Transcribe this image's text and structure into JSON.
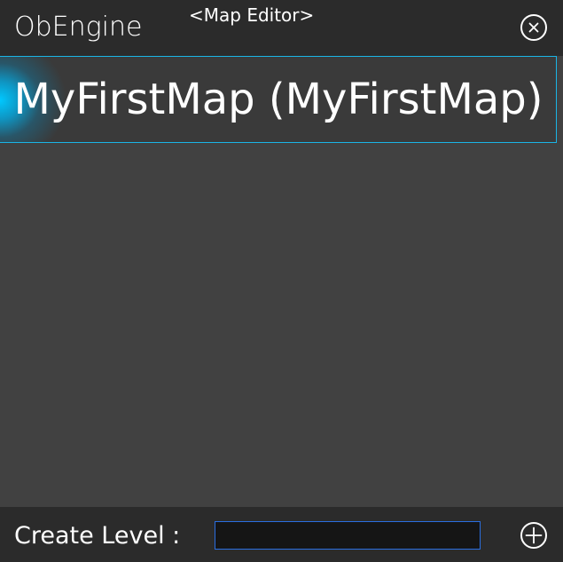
{
  "window": {
    "app_title": "ObEngine",
    "subtitle": "<Map Editor>",
    "close_icon": "close-icon"
  },
  "maps": [
    {
      "label": "MyFirstMap (MyFirstMap)",
      "selected": true
    }
  ],
  "footer": {
    "create_label": "Create Level :",
    "input_value": "",
    "add_icon": "plus-icon"
  },
  "colors": {
    "titlebar_bg": "#2b2b2b",
    "body_bg": "#414141",
    "accent": "#1ab5e6",
    "input_border": "#2a6ee0"
  }
}
